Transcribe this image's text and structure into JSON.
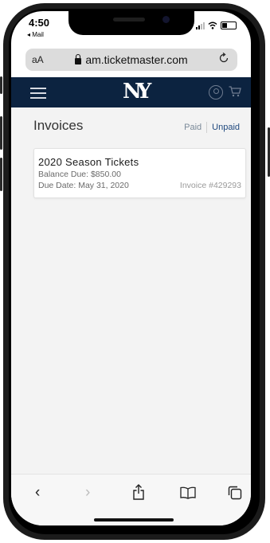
{
  "status_bar": {
    "time": "4:50",
    "back_label": "◂ Mail"
  },
  "url_bar": {
    "text_size_label": "aA",
    "url": "am.ticketmaster.com"
  },
  "site_header": {
    "logo_text": "NY"
  },
  "invoices": {
    "title": "Invoices",
    "filters": {
      "paid_label": "Paid",
      "unpaid_label": "Unpaid",
      "active": "Unpaid"
    },
    "items": [
      {
        "title": "2020 Season Tickets",
        "balance": "Balance Due: $850.00",
        "due_date": "Due Date: May 31, 2020",
        "invoice_number": "Invoice #429293"
      }
    ]
  },
  "toolbar": {
    "back_icon": "‹",
    "forward_icon": "›",
    "share_icon": "share-icon",
    "bookmarks_icon": "book-icon",
    "tabs_icon": "tabs-icon"
  },
  "colors": {
    "header_bg": "#0c2340",
    "accent": "#214a7f"
  }
}
